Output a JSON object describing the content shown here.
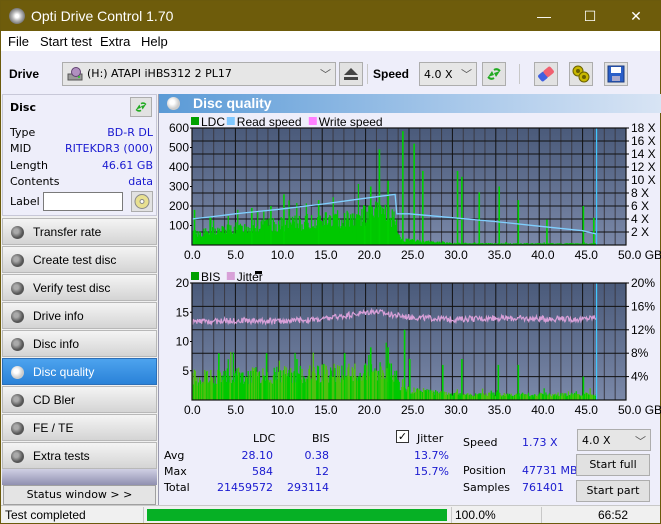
{
  "window": {
    "title": "Opti Drive Control 1.70",
    "minimize": "—",
    "maximize": "☐",
    "close": "✕"
  },
  "menu": [
    "File",
    "Start test",
    "Extra",
    "Help"
  ],
  "toolbar": {
    "drive_label": "Drive",
    "drive_value": "(H:)  ATAPI iHBS312  2 PL17",
    "speed_label": "Speed",
    "speed_value": "4.0 X",
    "icons": [
      "drive-icon",
      "eject-icon",
      "refresh-icon",
      "erase-icon",
      "config-icon",
      "save-icon"
    ]
  },
  "disc": {
    "title": "Disc",
    "rows": [
      {
        "key": "Type",
        "value": "BD-R DL"
      },
      {
        "key": "MID",
        "value": "RITEKDR3 (000)"
      },
      {
        "key": "Length",
        "value": "46.61 GB"
      },
      {
        "key": "Contents",
        "value": "data"
      }
    ],
    "label_key": "Label",
    "label_value": ""
  },
  "nav": [
    {
      "label": "Transfer rate",
      "active": false
    },
    {
      "label": "Create test disc",
      "active": false
    },
    {
      "label": "Verify test disc",
      "active": false
    },
    {
      "label": "Drive info",
      "active": false
    },
    {
      "label": "Disc info",
      "active": false
    },
    {
      "label": "Disc quality",
      "active": true
    },
    {
      "label": "CD Bler",
      "active": false
    },
    {
      "label": "FE / TE",
      "active": false
    },
    {
      "label": "Extra tests",
      "active": false
    }
  ],
  "status_window_label": "Status window > >",
  "main": {
    "title": "Disc quality"
  },
  "chart_data": [
    {
      "type": "bar",
      "title": "LDC",
      "legend": [
        {
          "name": "LDC",
          "color": "#00a000"
        },
        {
          "name": "Read speed",
          "color": "#80c8ff"
        },
        {
          "name": "Write speed",
          "color": "#ff80ff"
        }
      ],
      "xlabel": "GB",
      "x_ticks": [
        "0.0",
        "5.0",
        "10.0",
        "15.0",
        "20.0",
        "25.0",
        "30.0",
        "35.0",
        "40.0",
        "45.0",
        "50.0 GB"
      ],
      "xlim": [
        0,
        50
      ],
      "y_left_ticks": [
        "100",
        "200",
        "300",
        "400",
        "500",
        "600"
      ],
      "ylim_left": [
        0,
        600
      ],
      "y_right_ticks": [
        "2 X",
        "4 X",
        "6 X",
        "8 X",
        "10 X",
        "12 X",
        "14 X",
        "16 X",
        "18 X"
      ],
      "ylim_right": [
        0,
        18
      ],
      "ldc_base": [
        [
          0,
          60
        ],
        [
          5,
          90
        ],
        [
          10,
          110
        ],
        [
          15,
          130
        ],
        [
          20,
          160
        ],
        [
          22,
          190
        ],
        [
          23.3,
          130
        ],
        [
          24,
          30
        ],
        [
          25,
          25
        ],
        [
          30,
          10
        ],
        [
          35,
          8
        ],
        [
          40,
          8
        ],
        [
          45,
          8
        ],
        [
          46.6,
          8
        ]
      ],
      "ldc_spikes": [
        [
          0.2,
          180
        ],
        [
          6.8,
          190
        ],
        [
          9,
          200
        ],
        [
          10.5,
          260
        ],
        [
          14.5,
          230
        ],
        [
          19.8,
          200
        ],
        [
          20.5,
          300
        ],
        [
          21.5,
          490
        ],
        [
          22.5,
          330
        ],
        [
          24.2,
          584
        ],
        [
          25.5,
          520
        ],
        [
          26.5,
          380
        ],
        [
          30.5,
          380
        ],
        [
          31,
          350
        ],
        [
          33,
          270
        ],
        [
          35.3,
          300
        ],
        [
          37.5,
          230
        ],
        [
          40.8,
          130
        ],
        [
          45,
          200
        ],
        [
          46.2,
          140
        ]
      ],
      "read_speed": [
        [
          0,
          4.0
        ],
        [
          2,
          4.3
        ],
        [
          5,
          4.8
        ],
        [
          10,
          5.5
        ],
        [
          15,
          6.3
        ],
        [
          20,
          7.2
        ],
        [
          23.4,
          7.8
        ],
        [
          23.6,
          4.8
        ],
        [
          25,
          4.8
        ],
        [
          30,
          4.2
        ],
        [
          35,
          3.6
        ],
        [
          40,
          2.9
        ],
        [
          45,
          2.2
        ],
        [
          46.6,
          1.7
        ]
      ],
      "end_marker_gb": 46.61
    },
    {
      "type": "bar",
      "title": "BIS / Jitter",
      "legend": [
        {
          "name": "BIS",
          "color": "#00a000"
        },
        {
          "name": "Jitter",
          "color": "#d8a0d8"
        }
      ],
      "xlabel": "GB",
      "x_ticks": [
        "0.0",
        "5.0",
        "10.0",
        "15.0",
        "20.0",
        "25.0",
        "30.0",
        "35.0",
        "40.0",
        "45.0",
        "50.0 GB"
      ],
      "xlim": [
        0,
        50
      ],
      "y_left_ticks": [
        "5",
        "10",
        "15",
        "20"
      ],
      "ylim_left": [
        0,
        20
      ],
      "y_right_ticks": [
        "4%",
        "8%",
        "12%",
        "16%",
        "20%"
      ],
      "ylim_right": [
        0,
        20
      ],
      "bis_base": [
        [
          0,
          4
        ],
        [
          10,
          4.5
        ],
        [
          20,
          5
        ],
        [
          23.3,
          5
        ],
        [
          24,
          2
        ],
        [
          30,
          1
        ],
        [
          46.6,
          1
        ]
      ],
      "bis_spikes": [
        [
          3,
          8
        ],
        [
          8.5,
          8
        ],
        [
          12,
          7
        ],
        [
          17.5,
          8
        ],
        [
          20.5,
          9
        ],
        [
          22.5,
          9
        ],
        [
          24.4,
          12
        ],
        [
          25,
          7
        ],
        [
          28.8,
          6
        ],
        [
          31,
          7
        ],
        [
          35.2,
          6
        ],
        [
          37.5,
          6
        ],
        [
          45,
          4
        ]
      ],
      "jitter": [
        [
          0,
          13.3
        ],
        [
          5,
          13.6
        ],
        [
          10,
          13.5
        ],
        [
          15,
          13.8
        ],
        [
          18,
          14.5
        ],
        [
          21,
          15.2
        ],
        [
          23,
          14.6
        ],
        [
          25,
          14.2
        ],
        [
          30,
          13.8
        ],
        [
          35,
          14.0
        ],
        [
          40,
          13.9
        ],
        [
          45,
          13.8
        ],
        [
          46.6,
          14.2
        ]
      ],
      "end_marker_gb": 46.61
    }
  ],
  "stats": {
    "col_ldc": "LDC",
    "col_bis": "BIS",
    "jitter_label": "Jitter",
    "jitter_checked": true,
    "rows": [
      {
        "label": "Avg",
        "ldc": "28.10",
        "bis": "0.38",
        "jitter": "13.7%"
      },
      {
        "label": "Max",
        "ldc": "584",
        "bis": "12",
        "jitter": "15.7%"
      },
      {
        "label": "Total",
        "ldc": "21459572",
        "bis": "293114",
        "jitter": ""
      }
    ],
    "speed_label": "Speed",
    "speed_value": "1.73 X",
    "position_label": "Position",
    "position_value": "47731 MB",
    "samples_label": "Samples",
    "samples_value": "761401",
    "speed_select": "4.0 X",
    "start_full": "Start full",
    "start_part": "Start part"
  },
  "statusbar": {
    "text": "Test completed",
    "progress_percent": 100.0,
    "progress_text": "100.0%",
    "time": "66:52"
  }
}
